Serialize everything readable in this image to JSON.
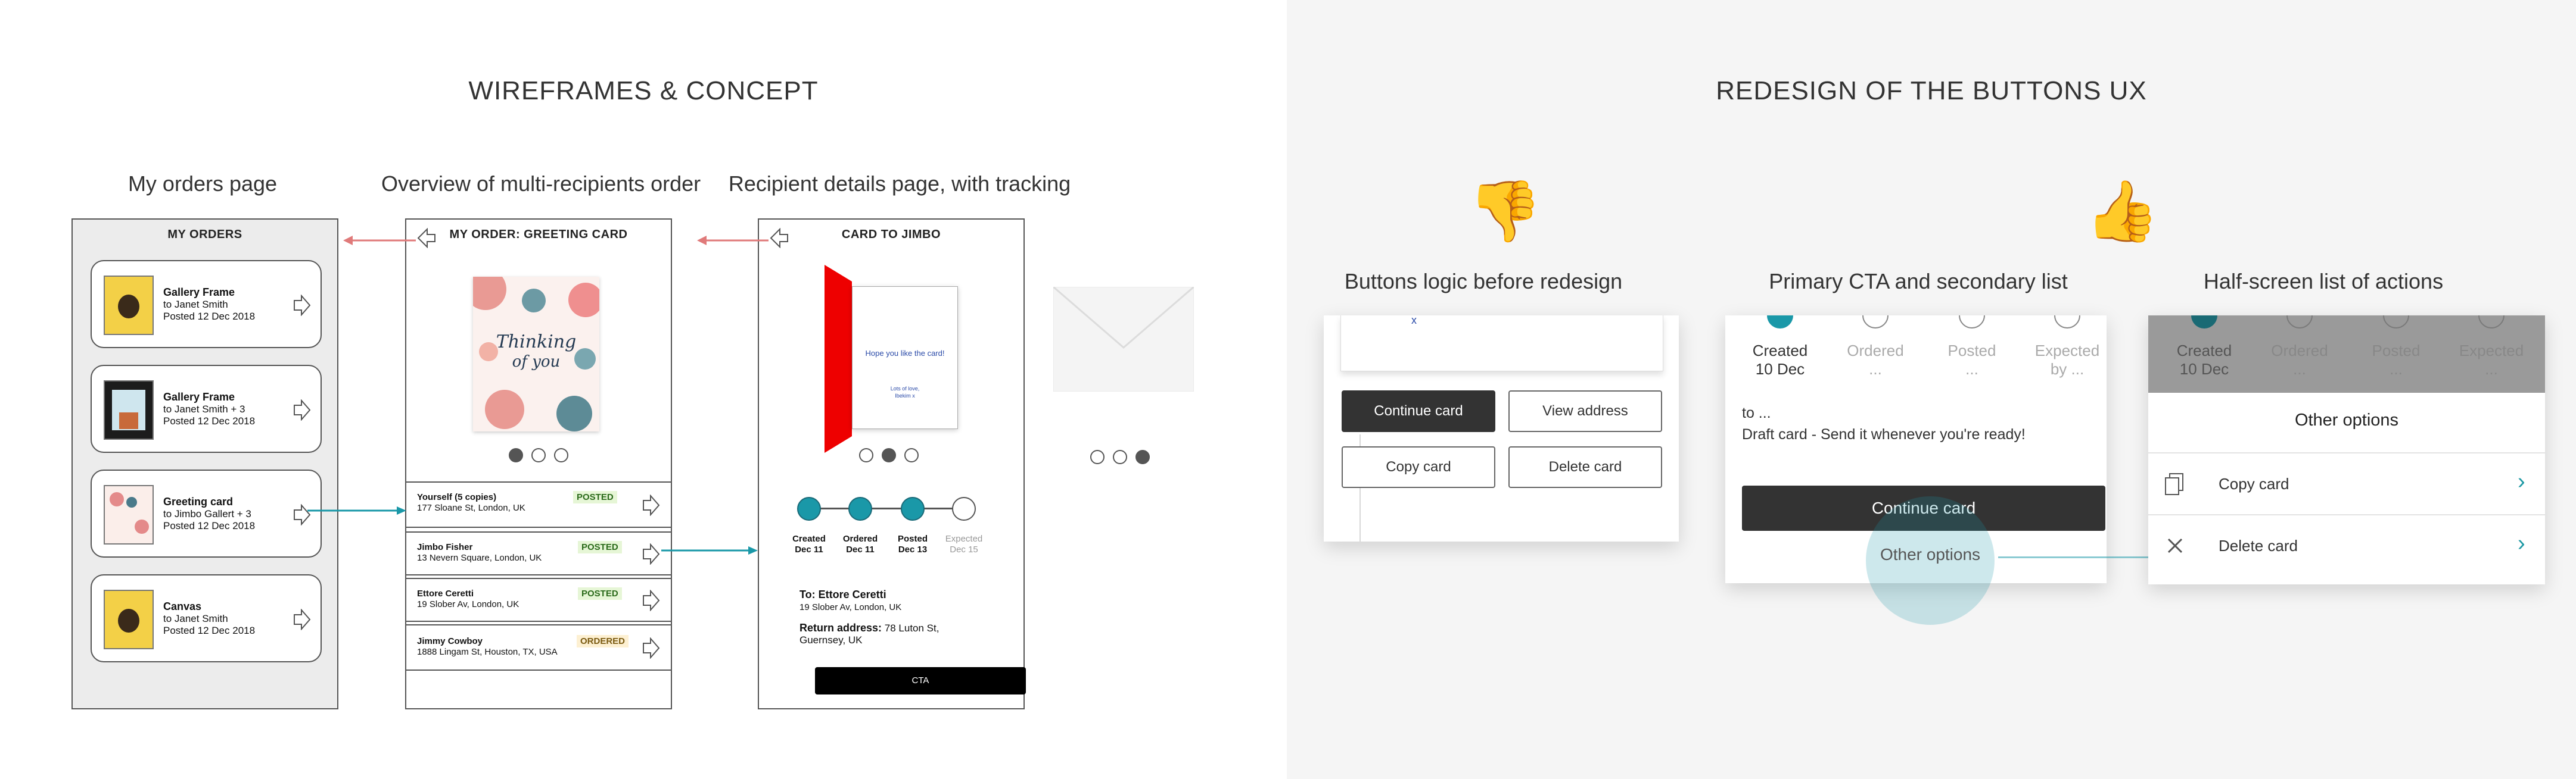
{
  "left": {
    "section_title": "WIREFRAMES & CONCEPT",
    "col_titles": [
      "My orders page",
      "Overview of multi-recipients order",
      "Recipient details page, with tracking"
    ],
    "my_orders": {
      "header": "MY ORDERS",
      "cards": [
        {
          "title": "Gallery Frame",
          "to": "to Janet Smith",
          "status": "Posted 12 Dec 2018"
        },
        {
          "title": "Gallery Frame",
          "to": "to Janet Smith + 3",
          "status": "Posted 12 Dec 2018"
        },
        {
          "title": "Greeting card",
          "to": "to Jimbo Gallert  + 3",
          "status": "Posted 12 Dec 2018"
        },
        {
          "title": "Canvas",
          "to": "to Janet Smith",
          "status": "Posted 12 Dec 2018"
        }
      ]
    },
    "overview": {
      "header": "MY ORDER: GREETING CARD",
      "card_art_line1": "Thinking",
      "card_art_line2": "of you",
      "recipients": [
        {
          "name": "Yourself (5 copies)",
          "address": "177 Sloane St, London, UK",
          "status": "POSTED"
        },
        {
          "name": "Jimbo Fisher",
          "address": "13 Nevern Square, London, UK",
          "status": "POSTED"
        },
        {
          "name": "Ettore Ceretti",
          "address": "19 Slober Av, London, UK",
          "status": "POSTED"
        },
        {
          "name": "Jimmy Cowboy",
          "address": "1888 Lingam St, Houston, TX, USA",
          "status": "ORDERED"
        }
      ]
    },
    "recipient": {
      "header": "CARD TO JIMBO",
      "card_message": "Hope you like the card!",
      "card_sign_line1": "Lots of love,",
      "card_sign_line2": "Ibekim x",
      "steps": [
        {
          "label": "Created",
          "date": "Dec 11"
        },
        {
          "label": "Ordered",
          "date": "Dec 11"
        },
        {
          "label": "Posted",
          "date": "Dec 13"
        },
        {
          "label": "Expected",
          "date": "Dec 15"
        }
      ],
      "to_label": "To: Ettore Ceretti",
      "to_address": "19 Slober Av, London, UK",
      "return_label": "Return address:",
      "return_line1": "78 Luton St,",
      "return_line2": "Guernsey, UK",
      "cta": "CTA"
    }
  },
  "right": {
    "section_title": "REDESIGN OF THE BUTTONS UX",
    "col_titles": [
      "Buttons logic before redesign",
      "Primary CTA and secondary list",
      "Half-screen list of actions"
    ],
    "thumbs_down_emoji": "👎",
    "thumbs_up_emoji": "👍",
    "before": {
      "mark": "x",
      "buttons": [
        "Continue card",
        "View address",
        "Copy card",
        "Delete card"
      ]
    },
    "primary": {
      "steps": [
        {
          "label": "Created",
          "sub": "10 Dec"
        },
        {
          "label": "Ordered",
          "sub": "..."
        },
        {
          "label": "Posted",
          "sub": "..."
        },
        {
          "label": "Expected",
          "sub": "by ..."
        }
      ],
      "to_line": "to ...",
      "draft_line": "Draft card - Send it whenever you're ready!",
      "cta": "Continue card",
      "secondary": "Other options"
    },
    "halfscreen": {
      "steps": [
        {
          "label": "Created",
          "sub": "10 Dec"
        },
        {
          "label": "Ordered",
          "sub": "..."
        },
        {
          "label": "Posted",
          "sub": "..."
        },
        {
          "label": "Expected",
          "sub": "..."
        }
      ],
      "sheet_title": "Other options",
      "items": [
        {
          "label": "Copy card",
          "icon": "copy-icon"
        },
        {
          "label": "Delete card",
          "icon": "close-icon"
        }
      ]
    }
  },
  "colors": {
    "teal": "#1a98a8",
    "red_arrow": "#e07a7a",
    "dark_button": "#333333",
    "right_bg": "#f5f5f5"
  }
}
